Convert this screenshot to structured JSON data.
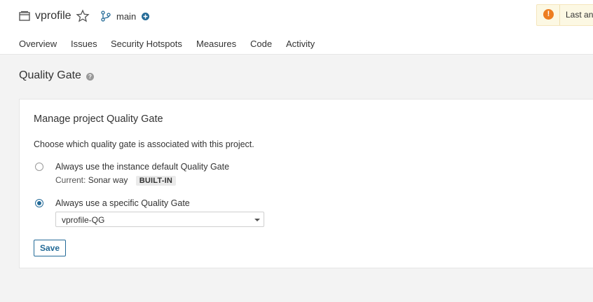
{
  "project": {
    "name": "vprofile",
    "branch": "main"
  },
  "warning": {
    "text": "Last an"
  },
  "nav": {
    "items": [
      "Overview",
      "Issues",
      "Security Hotspots",
      "Measures",
      "Code",
      "Activity"
    ]
  },
  "page": {
    "title": "Quality Gate"
  },
  "card": {
    "title": "Manage project Quality Gate",
    "description": "Choose which quality gate is associated with this project.",
    "option_default": {
      "label": "Always use the instance default Quality Gate",
      "current_label": "Current:",
      "current_value": "Sonar way",
      "badge": "BUILT-IN",
      "selected": false
    },
    "option_specific": {
      "label": "Always use a specific Quality Gate",
      "selected": true
    },
    "select": {
      "value": "vprofile-QG"
    },
    "save_label": "Save"
  },
  "colors": {
    "accent": "#236a97",
    "warning": "#ed7d20",
    "badge_bg": "#eaeaea"
  }
}
